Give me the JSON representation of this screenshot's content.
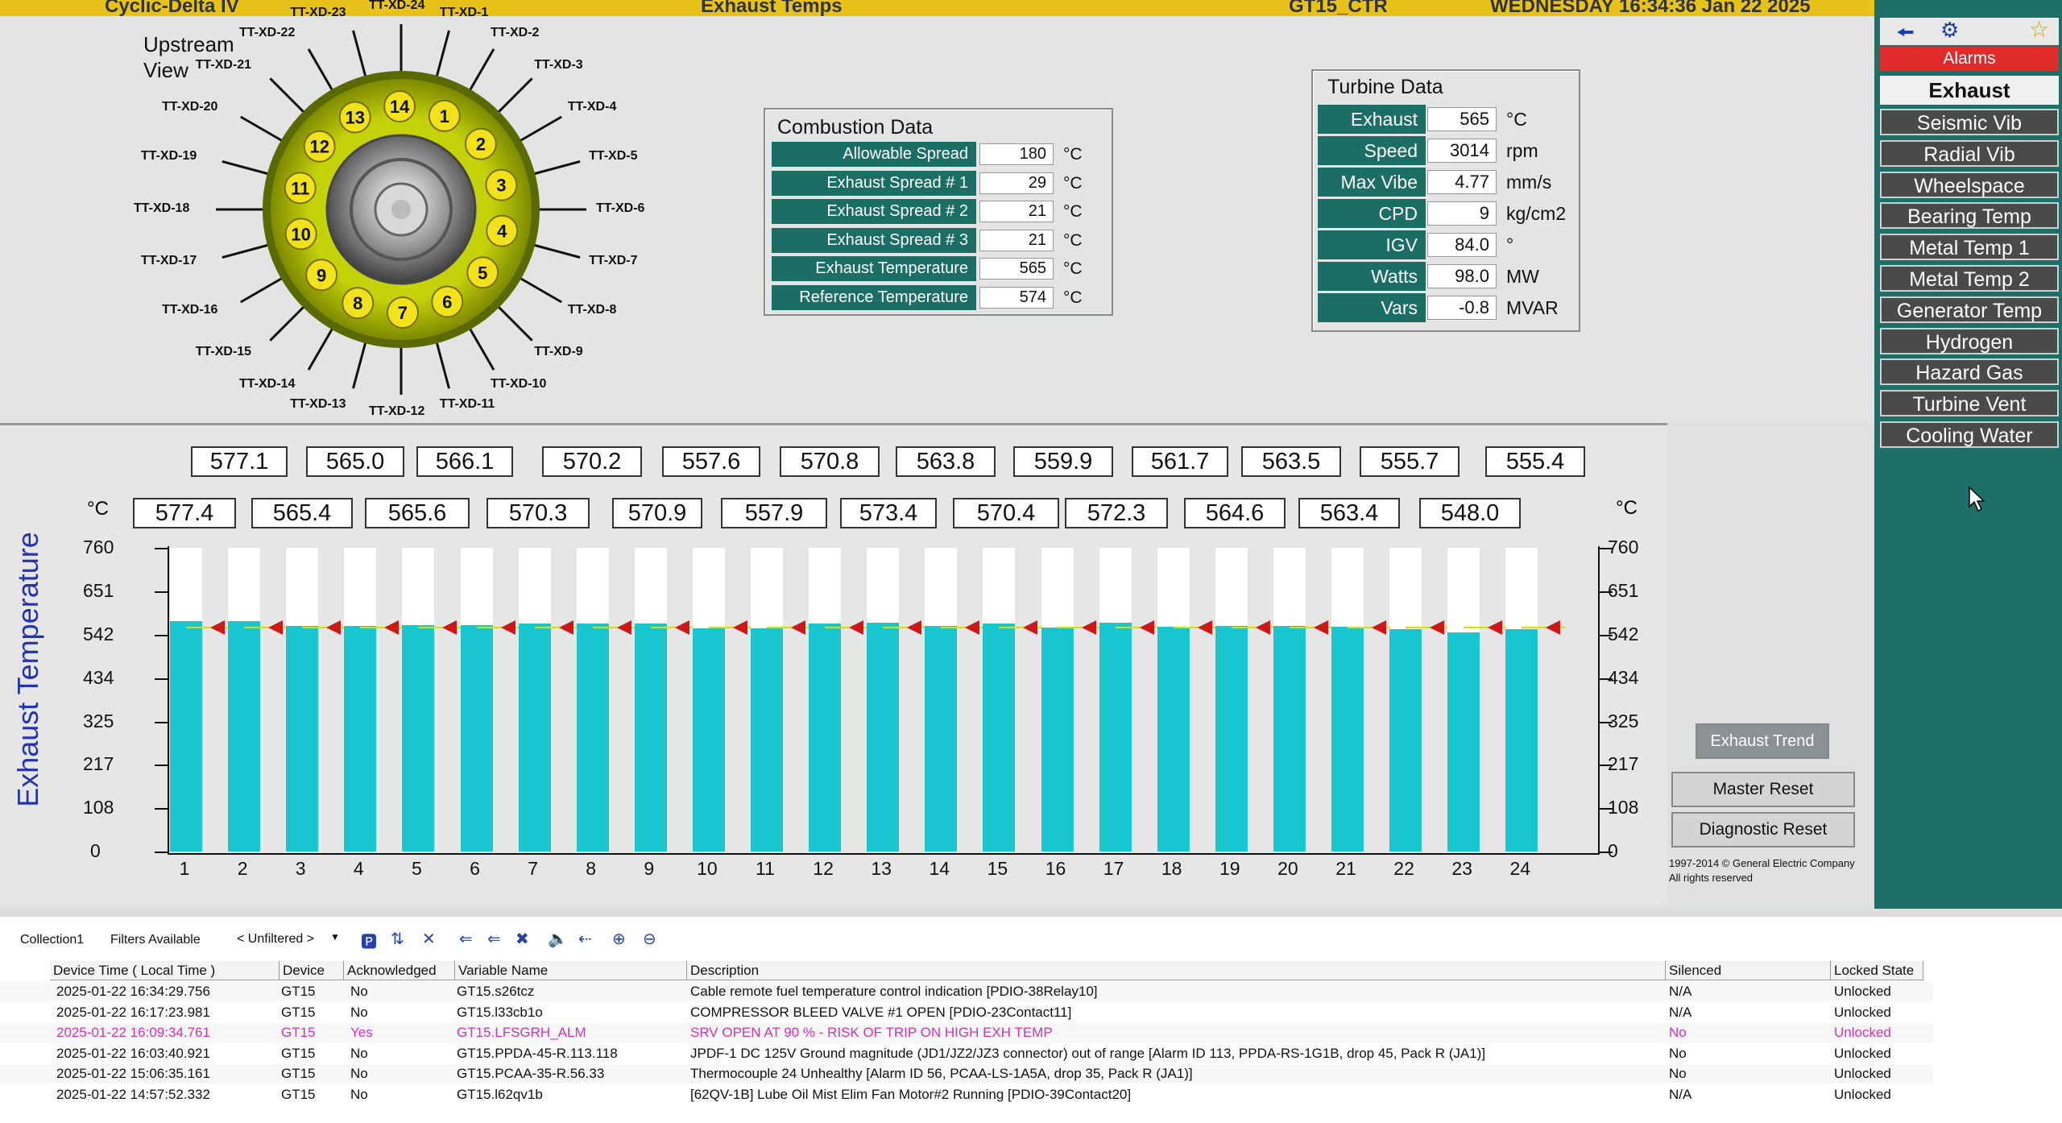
{
  "topbar": {
    "title_left": "Cyclic-Delta IV",
    "title_center": "Exhaust Temps",
    "unit": "GT15_CTR",
    "datetime": "WEDNESDAY 16:34:36 Jan 22 2025"
  },
  "upstream": {
    "view_label_1": "Upstream",
    "view_label_2": "View",
    "burners": [
      "1",
      "2",
      "3",
      "4",
      "5",
      "6",
      "7",
      "8",
      "9",
      "10",
      "11",
      "12",
      "13",
      "14"
    ],
    "thermocouples": [
      "TT-XD-1",
      "TT-XD-2",
      "TT-XD-3",
      "TT-XD-4",
      "TT-XD-5",
      "TT-XD-6",
      "TT-XD-7",
      "TT-XD-8",
      "TT-XD-9",
      "TT-XD-10",
      "TT-XD-11",
      "TT-XD-12",
      "TT-XD-13",
      "TT-XD-14",
      "TT-XD-15",
      "TT-XD-16",
      "TT-XD-17",
      "TT-XD-18",
      "TT-XD-19",
      "TT-XD-20",
      "TT-XD-21",
      "TT-XD-22",
      "TT-XD-23",
      "TT-XD-24"
    ]
  },
  "combustion": {
    "title": "Combustion Data",
    "rows": [
      {
        "label": "Allowable Spread",
        "value": "180",
        "unit": "°C"
      },
      {
        "label": "Exhaust Spread # 1",
        "value": "29",
        "unit": "°C"
      },
      {
        "label": "Exhaust Spread # 2",
        "value": "21",
        "unit": "°C"
      },
      {
        "label": "Exhaust Spread # 3",
        "value": "21",
        "unit": "°C"
      },
      {
        "label": "Exhaust Temperature",
        "value": "565",
        "unit": "°C"
      },
      {
        "label": "Reference Temperature",
        "value": "574",
        "unit": "°C"
      }
    ]
  },
  "turbine": {
    "title": "Turbine Data",
    "rows": [
      {
        "label": "Exhaust",
        "value": "565",
        "unit": "°C"
      },
      {
        "label": "Speed",
        "value": "3014",
        "unit": "rpm"
      },
      {
        "label": "Max Vibe",
        "value": "4.77",
        "unit": "mm/s"
      },
      {
        "label": "CPD",
        "value": "9",
        "unit": "kg/cm2"
      },
      {
        "label": "IGV",
        "value": "84.0",
        "unit": "°"
      },
      {
        "label": "Watts",
        "value": "98.0",
        "unit": "MW"
      },
      {
        "label": "Vars",
        "value": "-0.8",
        "unit": "MVAR"
      }
    ]
  },
  "nav": {
    "alarms": "Alarms",
    "active": "Exhaust",
    "items": [
      "Seismic Vib",
      "Radial Vib",
      "Wheelspace",
      "Bearing Temp",
      "Metal Temp 1",
      "Metal Temp 2",
      "Generator Temp",
      "Hydrogen",
      "Hazard Gas",
      "Turbine Vent",
      "Cooling Water"
    ]
  },
  "chart_data": {
    "type": "bar",
    "title": "",
    "ylabel": "Exhaust Temperature",
    "yunit": "°C",
    "ylim": [
      0,
      760
    ],
    "yticks": [
      0,
      108,
      217,
      325,
      434,
      542,
      651,
      760
    ],
    "categories": [
      "1",
      "2",
      "3",
      "4",
      "5",
      "6",
      "7",
      "8",
      "9",
      "10",
      "11",
      "12",
      "13",
      "14",
      "15",
      "16",
      "17",
      "18",
      "19",
      "20",
      "21",
      "22",
      "23",
      "24"
    ],
    "values": [
      577.4,
      577.1,
      565.4,
      565.0,
      565.6,
      566.1,
      570.3,
      570.2,
      570.9,
      557.6,
      557.9,
      570.8,
      573.4,
      563.8,
      570.4,
      559.9,
      572.3,
      561.7,
      564.6,
      563.5,
      563.4,
      555.7,
      548.0,
      555.4
    ],
    "reference_marker": 574,
    "value_labels_top": [
      "577.1",
      "565.0",
      "566.1",
      "570.2",
      "557.6",
      "570.8",
      "563.8",
      "559.9",
      "561.7",
      "563.5",
      "555.7",
      "555.4"
    ],
    "value_labels_bottom": [
      "577.4",
      "565.4",
      "565.6",
      "570.3",
      "570.9",
      "557.9",
      "573.4",
      "570.4",
      "572.3",
      "564.6",
      "563.4",
      "548.0"
    ],
    "bar_color": "#17c6cf",
    "marker_color": "#d01818"
  },
  "side_buttons": {
    "trend": "Exhaust Trend",
    "master": "Master Reset",
    "diag": "Diagnostic Reset"
  },
  "copyright": {
    "line1": "1997-2014 © General Electric Company",
    "line2": "All rights reserved"
  },
  "toolbar": {
    "collection": "Collection1",
    "filters": "Filters Available",
    "unfiltered": "< Unfiltered >"
  },
  "alarm_table": {
    "headers": [
      "Device Time ( Local Time )",
      "Device",
      "Acknowledged",
      "Variable Name",
      "Description",
      "Silenced",
      "Locked State"
    ],
    "rows": [
      {
        "time": "2025-01-22 16:34:29.756",
        "device": "GT15",
        "ack": "No",
        "var": "GT15.s26tcz",
        "desc": "Cable remote fuel temperature control indication [PDIO-38Relay10]",
        "silenced": "N/A",
        "locked": "Unlocked",
        "alarm": false
      },
      {
        "time": "2025-01-22 16:17:23.981",
        "device": "GT15",
        "ack": "No",
        "var": "GT15.l33cb1o",
        "desc": "COMPRESSOR BLEED VALVE #1 OPEN [PDIO-23Contact11]",
        "silenced": "N/A",
        "locked": "Unlocked",
        "alarm": false
      },
      {
        "time": "2025-01-22 16:09:34.761",
        "device": "GT15",
        "ack": "Yes",
        "var": "GT15.LFSGRH_ALM",
        "desc": "SRV OPEN AT 90 % - RISK OF TRIP ON HIGH EXH TEMP",
        "silenced": "No",
        "locked": "Unlocked",
        "alarm": true
      },
      {
        "time": "2025-01-22 16:03:40.921",
        "device": "GT15",
        "ack": "No",
        "var": "GT15.PPDA-45-R.113.118",
        "desc": "JPDF-1 DC 125V Ground magnitude (JD1/JZ2/JZ3 connector) out of range [Alarm ID 113, PPDA-RS-1G1B, drop 45, Pack R (JA1)]",
        "silenced": "No",
        "locked": "Unlocked",
        "alarm": false
      },
      {
        "time": "2025-01-22 15:06:35.161",
        "device": "GT15",
        "ack": "No",
        "var": "GT15.PCAA-35-R.56.33",
        "desc": "Thermocouple 24 Unhealthy [Alarm ID 56, PCAA-LS-1A5A, drop 35, Pack R (JA1)]",
        "silenced": "No",
        "locked": "Unlocked",
        "alarm": false
      },
      {
        "time": "2025-01-22 14:57:52.332",
        "device": "GT15",
        "ack": "No",
        "var": "GT15.l62qv1b",
        "desc": "[62QV-1B] Lube Oil Mist Elim Fan Motor#2 Running [PDIO-39Contact20]",
        "silenced": "N/A",
        "locked": "Unlocked",
        "alarm": false
      }
    ]
  }
}
